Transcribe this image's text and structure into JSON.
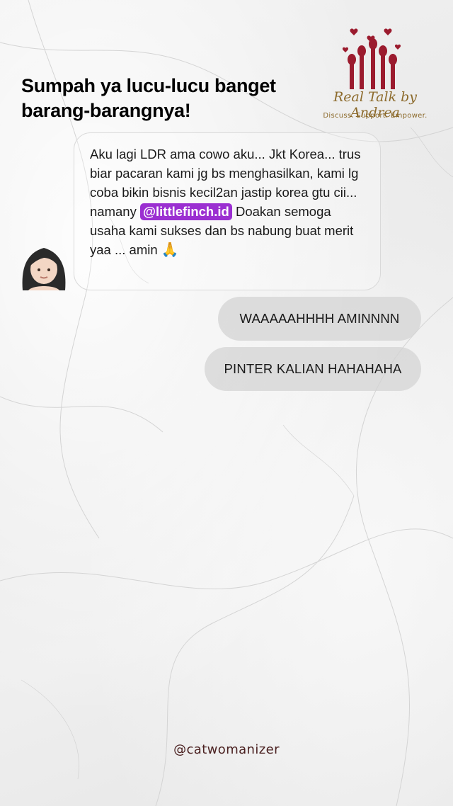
{
  "headline": {
    "line1": "Sumpah ya lucu-lucu banget",
    "line2": "barang-barangnya!"
  },
  "logo": {
    "name": "Real Talk by Andrea",
    "tagline": "Discuss. Support. Empower.",
    "mark_icon": "raised-hands-with-hearts-logo",
    "brand_color": "#9b1b2e",
    "text_color": "#8c6a2b"
  },
  "incoming_message": {
    "avatar_icon": "woman-emoji-avatar",
    "text_before_mention": "Aku lagi LDR  ama cowo aku... Jkt Korea... trus biar pacaran kami jg bs menghasilkan, kami lg coba bikin bisnis kecil2an jastip korea gtu cii... namany",
    "mention": "@littlefinch.id",
    "text_after_mention": "Doakan semoga usaha kami sukses dan bs nabung buat merit yaa ... amin",
    "emoji": "🙏",
    "mention_color": "#9b2fd1"
  },
  "replies": [
    {
      "text": "WAAAAAHHHH AMINNNN"
    },
    {
      "text": "PINTER KALIAN HAHAHAHA"
    }
  ],
  "credit": "@catwomanizer"
}
